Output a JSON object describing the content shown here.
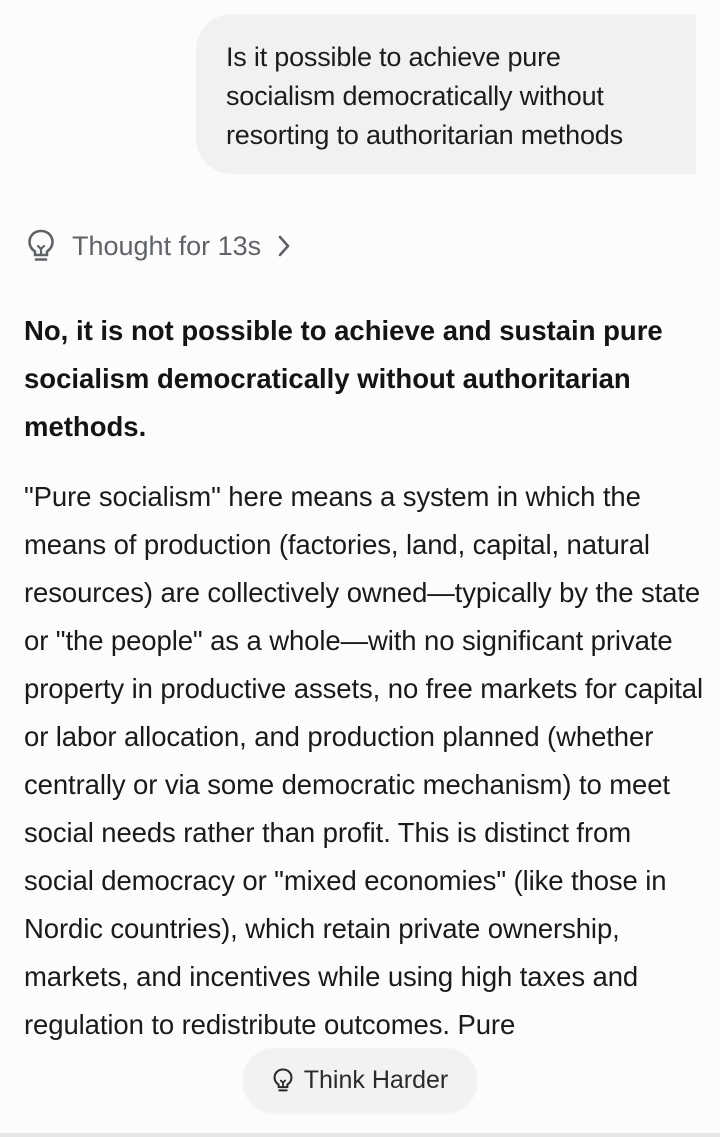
{
  "user_message": {
    "text": "Is it possible to achieve pure socialism democratically without resorting to authoritarian methods"
  },
  "thought": {
    "label": "Thought for 13s",
    "icon": "lightbulb-icon"
  },
  "response": {
    "heading": "No, it is not possible to achieve and sustain pure socialism democratically without authoritarian methods.",
    "paragraph": "\"Pure socialism\" here means a system in which the means of production (factories, land, capital, natural resources) are collectively owned—typically by the state or \"the people\" as a whole—with no significant private property in productive assets, no free markets for capital or labor allocation, and production planned (whether centrally or via some democratic mechanism) to meet social needs rather than profit. This is distinct from social democracy or \"mixed economies\" (like those in Nordic countries), which retain private ownership, markets, and incentives while using high taxes and regulation to redistribute outcomes. Pure"
  },
  "think_harder": {
    "label": "Think Harder",
    "icon": "lightbulb-icon"
  }
}
